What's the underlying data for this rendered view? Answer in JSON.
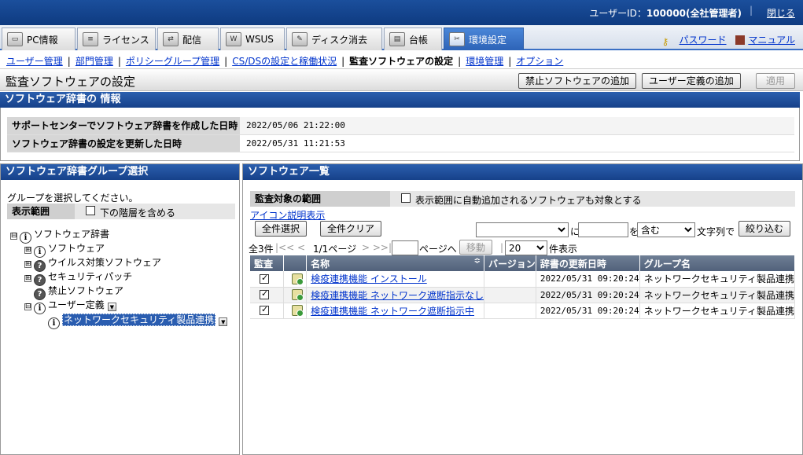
{
  "topbar": {
    "user_label": "ユーザーID：",
    "user_value": "100000(全社管理者)",
    "close": "閉じる"
  },
  "tabs": [
    {
      "label": "PC情報",
      "icon": "pc-icon"
    },
    {
      "label": "ライセンス",
      "icon": "license-icon"
    },
    {
      "label": "配信",
      "icon": "distribution-icon"
    },
    {
      "label": "WSUS",
      "icon": "wsus-icon"
    },
    {
      "label": "ディスク消去",
      "icon": "disk-erase-icon"
    },
    {
      "label": "台帳",
      "icon": "ledger-icon"
    },
    {
      "label": "環境設定",
      "icon": "settings-icon"
    }
  ],
  "toplinks": {
    "password": "パスワード",
    "manual": "マニュアル"
  },
  "subnav": [
    "ユーザー管理",
    "部門管理",
    "ポリシーグループ管理",
    "CS/DSの設定と稼働状況",
    "監査ソフトウェアの設定",
    "環境管理",
    "オプション"
  ],
  "page": {
    "title": "監査ソフトウェアの設定",
    "btn_add_prohibited": "禁止ソフトウェアの追加",
    "btn_add_user_def": "ユーザー定義の追加",
    "btn_apply": "適用"
  },
  "dict_info": {
    "header": "ソフトウェア辞書の 情報",
    "rows": [
      {
        "key": "サポートセンターでソフトウェア辞書を作成した日時",
        "value": "2022/05/06 21:22:00"
      },
      {
        "key": "ソフトウェア辞書の設定を更新した日時",
        "value": "2022/05/31 11:21:53"
      }
    ]
  },
  "group_select": {
    "header": "ソフトウェア辞書グループ選択",
    "prompt": "グループを選択してください。",
    "scope_label": "表示範囲",
    "include_sub": "下の階層を含める",
    "tree": [
      {
        "label": "ソフトウェア辞書",
        "expander": "⊟",
        "icon": "i",
        "level": 0
      },
      {
        "label": "ソフトウェア",
        "expander": "⊞",
        "icon": "i",
        "level": 1
      },
      {
        "label": "ウイルス対策ソフトウェア",
        "expander": "⊞",
        "icon": "?",
        "level": 1
      },
      {
        "label": "セキュリティパッチ",
        "expander": "⊞",
        "icon": "?",
        "level": 1
      },
      {
        "label": "禁止ソフトウェア",
        "expander": "",
        "icon": "?",
        "level": 1
      },
      {
        "label": "ユーザー定義",
        "expander": "⊟",
        "icon": "i",
        "level": 1
      },
      {
        "label": "ネットワークセキュリティ製品連携",
        "expander": "",
        "icon": "i",
        "level": 2
      }
    ]
  },
  "software_list": {
    "header": "ソフトウェア一覧",
    "scope_label": "監査対象の範囲",
    "auto_add_label": "表示範囲に自動追加されるソフトウェアも対象とする",
    "icon_legend": "アイコン説明表示",
    "select_all": "全件選択",
    "clear_all": "全件クリア",
    "filter_connector_ni": "に",
    "filter_connector_wo": "を",
    "filter_match": "含む",
    "filter_suffix": "文字列で",
    "filter_button": "絞り込む",
    "pager": {
      "total": "全3件",
      "nav_prev": "|<< <",
      "page_info": "1/1ページ",
      "nav_next": "> >>|",
      "goto_suffix": "ページへ",
      "move": "移動",
      "per_page": "20",
      "per_page_suffix": "件表示"
    },
    "columns": [
      "監査",
      "",
      "名称",
      "バージョン",
      "辞書の更新日時",
      "グループ名"
    ],
    "rows": [
      {
        "checked": true,
        "name": "検疫連携機能 インストール",
        "version": "",
        "updated": "2022/05/31 09:20:24",
        "group": "ネットワークセキュリティ製品連携"
      },
      {
        "checked": true,
        "name": "検疫連携機能 ネットワーク遮断指示なし",
        "version": "",
        "updated": "2022/05/31 09:20:24",
        "group": "ネットワークセキュリティ製品連携"
      },
      {
        "checked": true,
        "name": "検疫連携機能 ネットワーク遮断指示中",
        "version": "",
        "updated": "2022/05/31 09:20:24",
        "group": "ネットワークセキュリティ製品連携"
      }
    ]
  }
}
